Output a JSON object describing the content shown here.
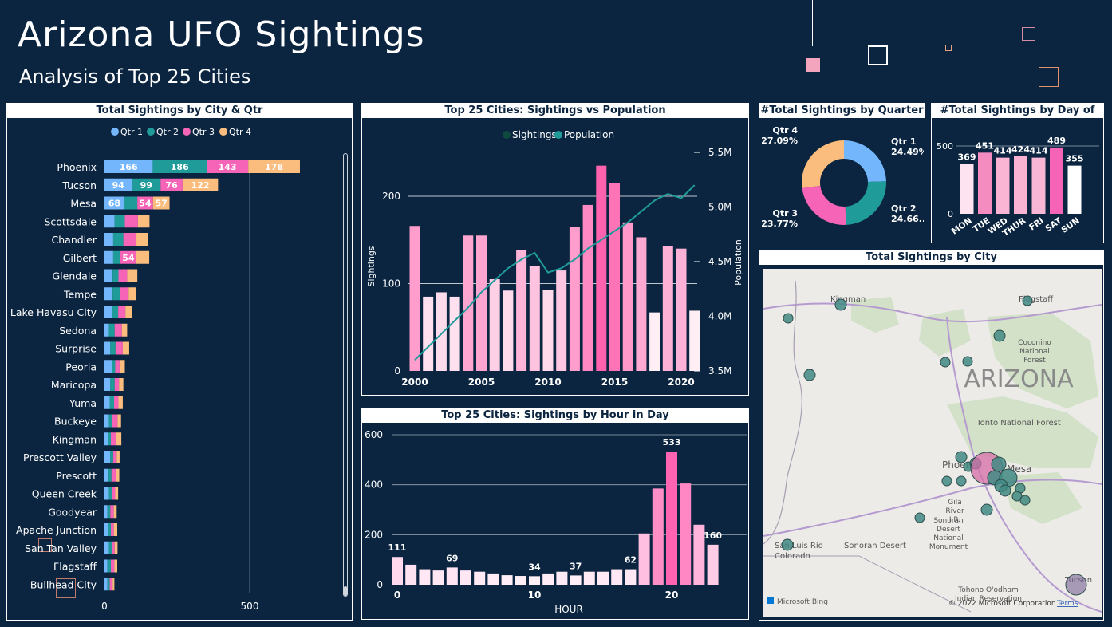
{
  "header": {
    "title": "Arizona UFO Sightings",
    "subtitle": "Analysis of Top 25 Cities"
  },
  "colors": {
    "background": "#0b2540",
    "q1": "#74b6fb",
    "q2": "#1f9b99",
    "q3": "#f564b6",
    "q4": "#fbbd7e"
  },
  "charts": [
    {
      "id": "city_qtr",
      "type": "bar",
      "orientation": "horizontal",
      "stacked": true,
      "title": "Total Sightings by City & Qtr",
      "legend_position": "top-center",
      "xlim": [
        0,
        820
      ],
      "x_ticks": [
        0,
        500
      ],
      "grid": true,
      "categories": [
        "Phoenix",
        "Tucson",
        "Mesa",
        "Scottsdale",
        "Chandler",
        "Gilbert",
        "Glendale",
        "Tempe",
        "Lake Havasu City",
        "Sedona",
        "Surprise",
        "Peoria",
        "Maricopa",
        "Yuma",
        "Buckeye",
        "Kingman",
        "Prescott Valley",
        "Prescott",
        "Queen Creek",
        "Goodyear",
        "Apache Junction",
        "San Tan Valley",
        "Flagstaff",
        "Bullhead City"
      ],
      "series": [
        {
          "name": "Qtr 1",
          "color": "#74b6fb",
          "values": [
            166,
            94,
            68,
            35,
            30,
            30,
            28,
            28,
            25,
            15,
            20,
            25,
            20,
            18,
            15,
            12,
            20,
            14,
            15,
            10,
            12,
            15,
            10,
            10
          ]
        },
        {
          "name": "Qtr 2",
          "color": "#1f9b99",
          "values": [
            186,
            99,
            45,
            35,
            35,
            25,
            20,
            25,
            22,
            20,
            18,
            12,
            15,
            15,
            10,
            10,
            10,
            10,
            10,
            10,
            10,
            10,
            12,
            8
          ]
        },
        {
          "name": "Qtr 3",
          "color": "#f564b6",
          "values": [
            143,
            76,
            54,
            45,
            45,
            54,
            30,
            30,
            25,
            25,
            25,
            15,
            15,
            15,
            20,
            18,
            12,
            15,
            12,
            12,
            10,
            10,
            12,
            10
          ]
        },
        {
          "name": "Qtr 4",
          "color": "#fbbd7e",
          "values": [
            178,
            122,
            57,
            40,
            40,
            45,
            35,
            25,
            22,
            18,
            22,
            18,
            15,
            15,
            12,
            18,
            10,
            12,
            10,
            10,
            12,
            10,
            10,
            6
          ]
        }
      ],
      "data_labels": [
        [
          "166",
          "186",
          "143",
          "178"
        ],
        [
          "94",
          "99",
          "76",
          "122"
        ],
        [
          "68",
          "",
          "54",
          "57"
        ],
        [
          "",
          "",
          "",
          ""
        ],
        [
          "",
          "",
          "",
          ""
        ],
        [
          "",
          "",
          "54",
          ""
        ]
      ]
    },
    {
      "id": "year_combo",
      "type": "bar",
      "title": "Top 25 Cities: Sightings vs Population",
      "legend": [
        "Sightings",
        "Population"
      ],
      "legend_colors": [
        "#0f4a3f",
        "#1f9b99"
      ],
      "ylabel": "Sightings",
      "y2label": "Population",
      "ylim": [
        0,
        240
      ],
      "y_ticks": [
        0,
        100,
        200
      ],
      "y2lim": [
        3.5,
        5.55
      ],
      "y2_ticks": [
        "3.5M",
        "4.0M",
        "4.5M",
        "5.0M",
        "5.5M"
      ],
      "y2_tick_values": [
        3.5,
        4.0,
        4.5,
        5.0,
        5.5
      ],
      "x_ticks": [
        2000,
        2005,
        2010,
        2015,
        2020
      ],
      "x": [
        2000,
        2001,
        2002,
        2003,
        2004,
        2005,
        2006,
        2007,
        2008,
        2009,
        2010,
        2011,
        2012,
        2013,
        2014,
        2015,
        2016,
        2017,
        2018,
        2019,
        2020,
        2021
      ],
      "sightings": [
        166,
        85,
        90,
        85,
        155,
        155,
        105,
        92,
        138,
        120,
        93,
        115,
        165,
        190,
        235,
        215,
        170,
        153,
        67,
        143,
        140,
        69
      ],
      "population_m": [
        3.6,
        3.72,
        3.84,
        3.96,
        4.08,
        4.22,
        4.33,
        4.44,
        4.52,
        4.58,
        4.4,
        4.44,
        4.52,
        4.62,
        4.7,
        4.78,
        4.86,
        4.96,
        5.06,
        5.12,
        5.08,
        5.2
      ],
      "population_color": "#1f9b99"
    },
    {
      "id": "hour",
      "type": "bar",
      "title": "Top 25 Cities: Sightings by Hour in Day",
      "xlabel": "HOUR",
      "ylim": [
        0,
        620
      ],
      "y_ticks": [
        0,
        200,
        400,
        600
      ],
      "x_ticks": [
        0,
        10,
        20
      ],
      "x": [
        0,
        1,
        2,
        3,
        4,
        5,
        6,
        7,
        8,
        9,
        10,
        11,
        12,
        13,
        14,
        15,
        16,
        17,
        18,
        19,
        20,
        21,
        22,
        23
      ],
      "values": [
        111,
        80,
        62,
        57,
        69,
        57,
        52,
        45,
        38,
        35,
        34,
        45,
        52,
        37,
        52,
        52,
        62,
        62,
        205,
        385,
        533,
        405,
        240,
        160
      ],
      "data_labels": {
        "0": "111",
        "4": "69",
        "10": "34",
        "13": "37",
        "17": "62",
        "20": "533",
        "23": "160"
      }
    },
    {
      "id": "quarter",
      "type": "pie",
      "donut": true,
      "title": "#Total Sightings by Quarter",
      "categories": [
        "Qtr 1",
        "Qtr 2",
        "Qtr 3",
        "Qtr 4"
      ],
      "values": [
        24.49,
        24.66,
        23.77,
        27.09
      ],
      "labels": [
        [
          "Qtr 1",
          "24.49%"
        ],
        [
          "Qtr 2",
          "24.66..."
        ],
        [
          "Qtr 3",
          "23.77%"
        ],
        [
          "Qtr 4",
          "27.09%"
        ]
      ],
      "colors": [
        "#74b6fb",
        "#1f9b99",
        "#f564b6",
        "#fbbd7e"
      ]
    },
    {
      "id": "dow",
      "type": "bar",
      "title": "#Total Sightings by Day of Week",
      "ylim": [
        0,
        560
      ],
      "y_ticks": [
        0,
        500
      ],
      "categories": [
        "MON",
        "TUE",
        "WED",
        "THUR",
        "FRI",
        "SAT",
        "SUN"
      ],
      "values": [
        369,
        451,
        414,
        424,
        414,
        489,
        355
      ],
      "labels": [
        "369",
        "451",
        "414",
        "424",
        "414",
        "489",
        "355"
      ]
    }
  ],
  "map": {
    "title": "Total Sightings by City",
    "region_label": "ARIZONA",
    "places": [
      "Kingman",
      "Flagstaff",
      "Coconino National Forest",
      "Tonto National Forest",
      "Phoenix",
      "Mesa",
      "Gila River I.R.",
      "Sonoran Desert National Monument",
      "Sonoran Desert",
      "San Luis Río Colorado",
      "Tohono O'odham Indian Reservation",
      "Tucson"
    ],
    "attribution": "Microsoft Bing",
    "copyright": "© 2022 Microsoft Corporation",
    "terms": "Terms"
  }
}
